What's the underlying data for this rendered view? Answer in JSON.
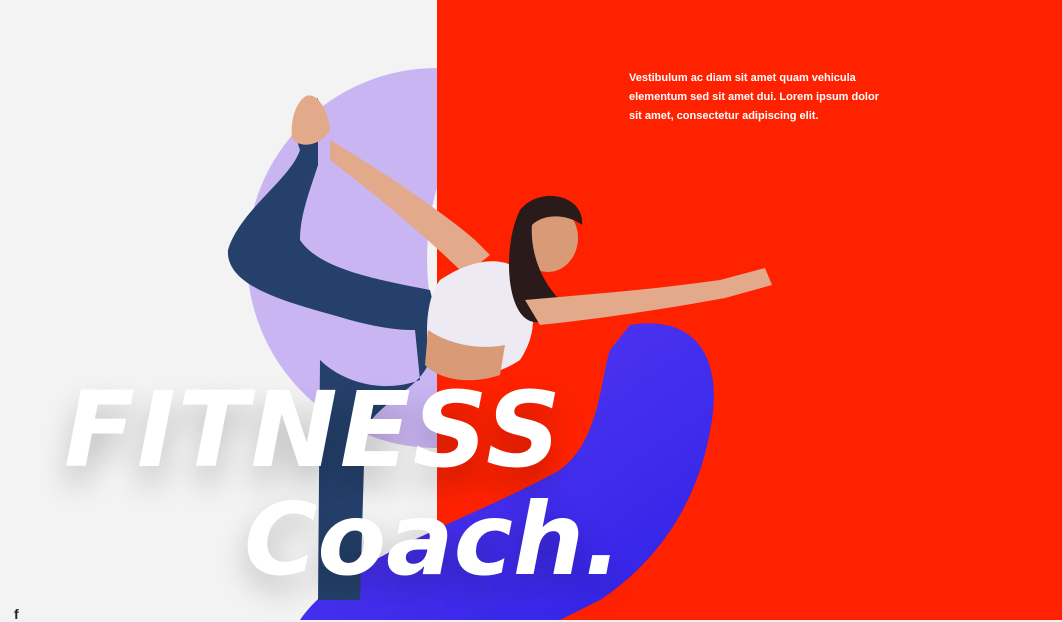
{
  "hero": {
    "intro_text": "Vestibulum ac diam sit amet quam vehicula elementum sed sit amet dui. Lorem ipsum dolor sit amet, consectetur adipiscing elit.",
    "headline_line1": "FITNESS",
    "headline_line2": "Coach.",
    "social_icon": "f"
  },
  "colors": {
    "left_bg": "#f3f3f3",
    "right_bg": "#ff2200",
    "ring": "#c9b5f2",
    "swoosh": "#3a2cf0",
    "text": "#ffffff"
  },
  "icons": [
    "facebook-icon"
  ]
}
